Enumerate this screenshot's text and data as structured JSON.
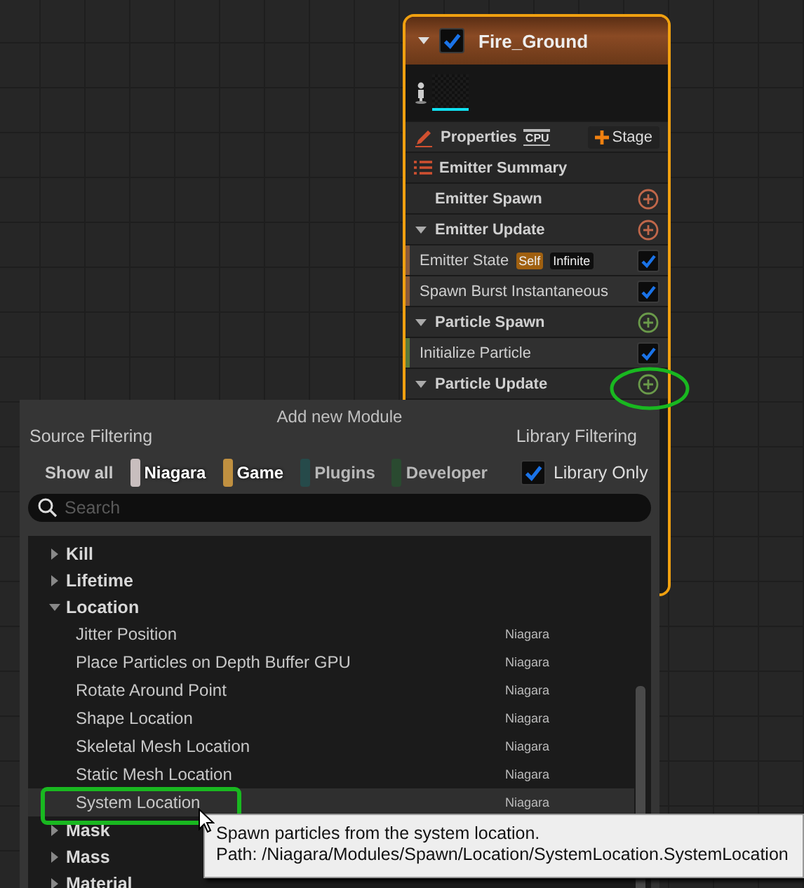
{
  "emitter": {
    "title": "Fire_Ground",
    "enabled": true,
    "properties": "Properties",
    "sim_target": "CPU",
    "stage_button": "Stage",
    "sections": [
      {
        "kind": "summary",
        "label": "Emitter Summary"
      },
      {
        "kind": "stage_empty",
        "label": "Emitter Spawn",
        "color": "#c0674a"
      },
      {
        "kind": "stage",
        "label": "Emitter Update",
        "color": "#c0674a",
        "expanded": true
      },
      {
        "kind": "module",
        "label": "Emitter State",
        "color": "#8a5a3a",
        "enabled": true,
        "tags": [
          {
            "label": "Self",
            "color": "#a06010"
          },
          {
            "label": "Infinite",
            "color": "#0e0e0e"
          }
        ]
      },
      {
        "kind": "module",
        "label": "Spawn Burst Instantaneous",
        "color": "#8a5a3a",
        "enabled": true
      },
      {
        "kind": "stage",
        "label": "Particle Spawn",
        "color": "#6a9a4a",
        "expanded": true
      },
      {
        "kind": "module",
        "label": "Initialize Particle",
        "color": "#5a7a3a",
        "enabled": true
      },
      {
        "kind": "stage",
        "label": "Particle Update",
        "color": "#6a9a4a",
        "expanded": true
      }
    ]
  },
  "popup": {
    "title": "Add new Module",
    "source_filtering": "Source Filtering",
    "library_filtering": "Library Filtering",
    "filters": [
      {
        "kind": "all",
        "label": "Show all"
      },
      {
        "kind": "source",
        "label": "Niagara",
        "color": "#c8bebe",
        "selected": true
      },
      {
        "kind": "source",
        "label": "Game",
        "color": "#c09040",
        "selected": true
      },
      {
        "kind": "source",
        "label": "Plugins",
        "color": "#264a4a",
        "selected": false
      },
      {
        "kind": "source",
        "label": "Developer",
        "color": "#2a4a30",
        "selected": false
      }
    ],
    "library_only": {
      "label": "Library Only",
      "checked": true
    },
    "search": {
      "placeholder": "Search"
    },
    "tree": [
      {
        "label": "Kill",
        "expanded": false
      },
      {
        "label": "Lifetime",
        "expanded": false
      },
      {
        "label": "Location",
        "expanded": true,
        "children": [
          {
            "label": "Jitter Position",
            "source": "Niagara",
            "selected": false
          },
          {
            "label": "Place Particles on Depth Buffer GPU",
            "source": "Niagara",
            "selected": false
          },
          {
            "label": "Rotate Around Point",
            "source": "Niagara",
            "selected": false
          },
          {
            "label": "Shape Location",
            "source": "Niagara",
            "selected": false
          },
          {
            "label": "Skeletal Mesh Location",
            "source": "Niagara",
            "selected": false
          },
          {
            "label": "Static Mesh Location",
            "source": "Niagara",
            "selected": false
          },
          {
            "label": "System Location",
            "source": "Niagara",
            "selected": true
          }
        ]
      },
      {
        "label": "Mask",
        "expanded": false
      },
      {
        "label": "Mass",
        "expanded": false
      },
      {
        "label": "Material",
        "expanded": false
      }
    ]
  },
  "tooltip": {
    "description": "Spawn particles from the system location.",
    "path": "Path: /Niagara/Modules/Spawn/Location/SystemLocation.SystemLocation"
  }
}
